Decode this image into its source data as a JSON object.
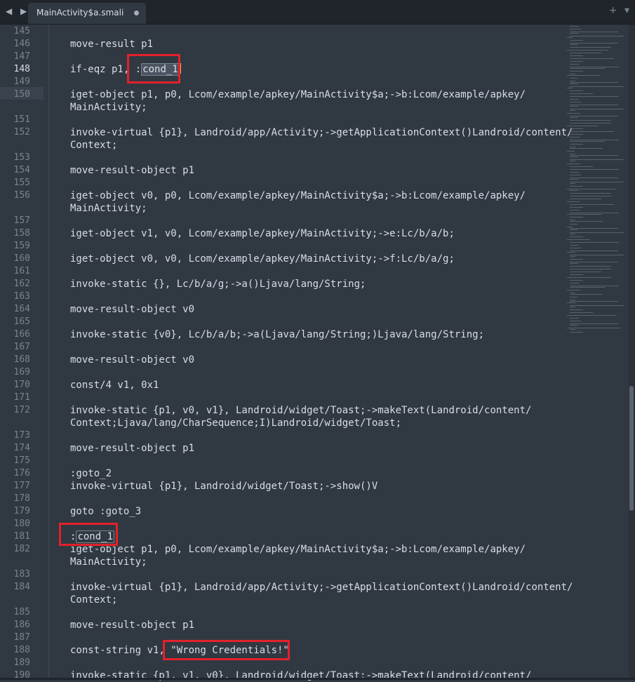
{
  "tabbar": {
    "tab_label": "MainActivity$a.smali",
    "nav_icons": "◀ ▶",
    "add_icon": "+",
    "menu_icon": "▾"
  },
  "editor": {
    "current_line": 148,
    "lines": [
      {
        "n": "145",
        "text": ""
      },
      {
        "n": "146",
        "text": "move-result p1"
      },
      {
        "n": "147",
        "text": ""
      },
      {
        "n": "148",
        "text": "if-eqz p1, :cond_1"
      },
      {
        "n": "149",
        "text": ""
      },
      {
        "n": "150",
        "text": "iget-object p1, p0, Lcom/example/apkey/MainActivity$a;->b:Lcom/example/apkey/"
      },
      {
        "n": "",
        "text": "MainActivity;"
      },
      {
        "n": "151",
        "text": ""
      },
      {
        "n": "152",
        "text": "invoke-virtual {p1}, Landroid/app/Activity;->getApplicationContext()Landroid/content/"
      },
      {
        "n": "",
        "text": "Context;"
      },
      {
        "n": "153",
        "text": ""
      },
      {
        "n": "154",
        "text": "move-result-object p1"
      },
      {
        "n": "155",
        "text": ""
      },
      {
        "n": "156",
        "text": "iget-object v0, p0, Lcom/example/apkey/MainActivity$a;->b:Lcom/example/apkey/"
      },
      {
        "n": "",
        "text": "MainActivity;"
      },
      {
        "n": "157",
        "text": ""
      },
      {
        "n": "158",
        "text": "iget-object v1, v0, Lcom/example/apkey/MainActivity;->e:Lc/b/a/b;"
      },
      {
        "n": "159",
        "text": ""
      },
      {
        "n": "160",
        "text": "iget-object v0, v0, Lcom/example/apkey/MainActivity;->f:Lc/b/a/g;"
      },
      {
        "n": "161",
        "text": ""
      },
      {
        "n": "162",
        "text": "invoke-static {}, Lc/b/a/g;->a()Ljava/lang/String;"
      },
      {
        "n": "163",
        "text": ""
      },
      {
        "n": "164",
        "text": "move-result-object v0"
      },
      {
        "n": "165",
        "text": ""
      },
      {
        "n": "166",
        "text": "invoke-static {v0}, Lc/b/a/b;->a(Ljava/lang/String;)Ljava/lang/String;"
      },
      {
        "n": "167",
        "text": ""
      },
      {
        "n": "168",
        "text": "move-result-object v0"
      },
      {
        "n": "169",
        "text": ""
      },
      {
        "n": "170",
        "text": "const/4 v1, 0x1"
      },
      {
        "n": "171",
        "text": ""
      },
      {
        "n": "172",
        "text": "invoke-static {p1, v0, v1}, Landroid/widget/Toast;->makeText(Landroid/content/"
      },
      {
        "n": "",
        "text": "Context;Ljava/lang/CharSequence;I)Landroid/widget/Toast;"
      },
      {
        "n": "173",
        "text": ""
      },
      {
        "n": "174",
        "text": "move-result-object p1"
      },
      {
        "n": "175",
        "text": ""
      },
      {
        "n": "176",
        "text": ":goto_2"
      },
      {
        "n": "177",
        "text": "invoke-virtual {p1}, Landroid/widget/Toast;->show()V"
      },
      {
        "n": "178",
        "text": ""
      },
      {
        "n": "179",
        "text": "goto :goto_3"
      },
      {
        "n": "180",
        "text": ""
      },
      {
        "n": "181",
        "text": ":cond_1"
      },
      {
        "n": "182",
        "text": "iget-object p1, p0, Lcom/example/apkey/MainActivity$a;->b:Lcom/example/apkey/"
      },
      {
        "n": "",
        "text": "MainActivity;"
      },
      {
        "n": "183",
        "text": ""
      },
      {
        "n": "184",
        "text": "invoke-virtual {p1}, Landroid/app/Activity;->getApplicationContext()Landroid/content/"
      },
      {
        "n": "",
        "text": "Context;"
      },
      {
        "n": "185",
        "text": ""
      },
      {
        "n": "186",
        "text": "move-result-object p1"
      },
      {
        "n": "187",
        "text": ""
      },
      {
        "n": "188",
        "text": "const-string v1, \"Wrong Credentials!\""
      },
      {
        "n": "189",
        "text": ""
      },
      {
        "n": "190",
        "text": "invoke-static {p1, v1, v0}, Landroid/widget/Toast;->makeText(Landroid/content/"
      }
    ]
  },
  "colors": {
    "background": "#303841",
    "text": "#d8dee9",
    "line_number": "#7b848d",
    "annotation_box": "#e3212b",
    "caret": "#f9ae58"
  }
}
